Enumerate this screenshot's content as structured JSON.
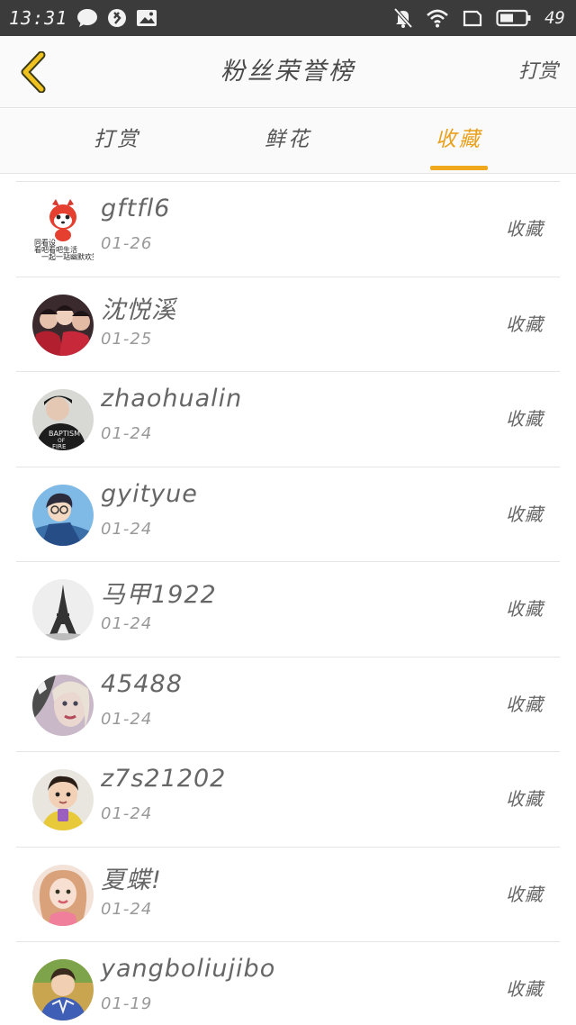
{
  "status_bar": {
    "time": "13:31",
    "battery": "49"
  },
  "header": {
    "title": "粉丝荣誉榜",
    "action": "打赏"
  },
  "tabs": [
    {
      "label": "打赏",
      "active": false
    },
    {
      "label": "鲜花",
      "active": false
    },
    {
      "label": "收藏",
      "active": true
    }
  ],
  "colors": {
    "accent": "#f0a81d",
    "status_bar": "#3b3b3b"
  },
  "list": [
    {
      "name": "gftfl6",
      "date": "01-26",
      "action": "收藏",
      "logo_text": [
        "同看设",
        "看吧看吧生活",
        "一起一站幽默欢笑"
      ]
    },
    {
      "name": "沈悦溪",
      "date": "01-25",
      "action": "收藏"
    },
    {
      "name": "zhaohualin",
      "date": "01-24",
      "action": "收藏",
      "shirt_text": [
        "BAPTISM",
        "OF",
        "FIRE"
      ]
    },
    {
      "name": "gyityue",
      "date": "01-24",
      "action": "收藏"
    },
    {
      "name": "马甲1922",
      "date": "01-24",
      "action": "收藏"
    },
    {
      "name": "45488",
      "date": "01-24",
      "action": "收藏"
    },
    {
      "name": "z7s21202",
      "date": "01-24",
      "action": "收藏"
    },
    {
      "name": "夏蝶!",
      "date": "01-24",
      "action": "收藏"
    },
    {
      "name": "yangboliujibo",
      "date": "01-19",
      "action": "收藏"
    }
  ]
}
